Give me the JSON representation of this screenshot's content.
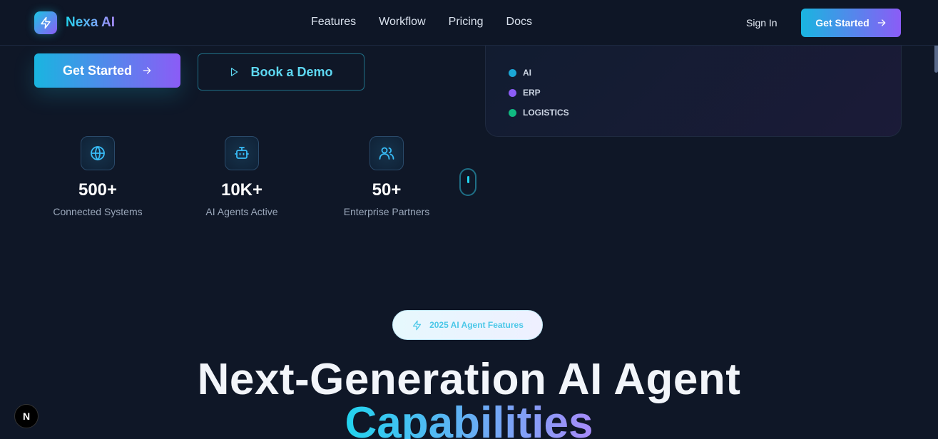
{
  "nav": {
    "brand": "Nexa AI",
    "links": [
      "Features",
      "Workflow",
      "Pricing",
      "Docs"
    ],
    "sign_in": "Sign In",
    "cta": "Get Started"
  },
  "hero": {
    "cta": "Get Started",
    "demo": "Book a Demo"
  },
  "legend": [
    {
      "label": "AI",
      "color": "#1ba7d6"
    },
    {
      "label": "ERP",
      "color": "#8b5cf6"
    },
    {
      "label": "LOGISTICS",
      "color": "#10b981"
    }
  ],
  "stats": [
    {
      "icon": "globe-icon",
      "value": "500+",
      "label": "Connected Systems"
    },
    {
      "icon": "bot-icon",
      "value": "10K+",
      "label": "AI Agents Active"
    },
    {
      "icon": "users-icon",
      "value": "50+",
      "label": "Enterprise Partners"
    }
  ],
  "features": {
    "badge": "2025 AI Agent Features",
    "headline": "Next-Generation AI Agent",
    "headline_highlight": "Capabilities"
  },
  "dev_badge": "N",
  "colors": {
    "accent_cyan": "#22d3ee",
    "accent_purple": "#8b5cf6",
    "background": "#0f1727"
  }
}
